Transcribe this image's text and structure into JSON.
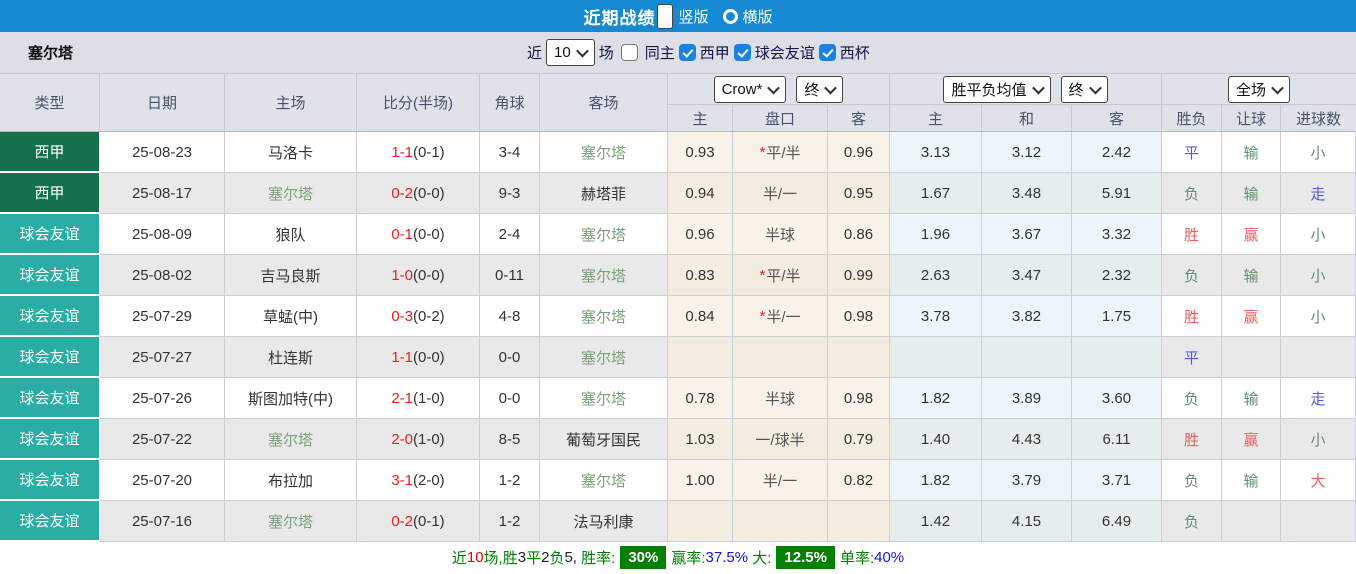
{
  "title_bar": {
    "title": "近期战绩",
    "radio_vertical": "竖版",
    "radio_horizontal": "横版"
  },
  "filter_bar": {
    "team": "塞尔塔",
    "near_label": "近",
    "count_value": "10",
    "games_label": "场",
    "same_home_label": "同主",
    "leagues": [
      "西甲",
      "球会友谊",
      "西杯"
    ]
  },
  "table": {
    "main_headers": [
      "类型",
      "日期",
      "主场",
      "比分(半场)",
      "角球",
      "客场"
    ],
    "group1": {
      "bookmaker_select": "Crow*",
      "stage_select": "终",
      "sub": [
        "主",
        "盘口",
        "客"
      ]
    },
    "group2": {
      "odds_select": "胜平负均值",
      "stage_select": "终",
      "sub": [
        "主",
        "和",
        "客"
      ]
    },
    "group3": {
      "scope_select": "全场",
      "sub": [
        "胜负",
        "让球",
        "进球数"
      ]
    },
    "type_colors": {
      "西甲": "#15714b",
      "球会友谊": "#2aada4"
    },
    "rows": [
      {
        "type": "西甲",
        "date": "25-08-23",
        "home": {
          "name": "马洛卡",
          "highlight": false
        },
        "score": {
          "full": "1-1",
          "half": "(0-1)"
        },
        "corners": "3-4",
        "away": {
          "name": "塞尔塔",
          "highlight": true
        },
        "crow": {
          "home": "0.93",
          "line_star": true,
          "line": "平/半",
          "away": "0.96"
        },
        "avg": {
          "home": "3.13",
          "draw": "3.12",
          "away": "2.42"
        },
        "outcome": {
          "text": "平",
          "color": "blue"
        },
        "handicap_result": {
          "text": "输",
          "color": "green"
        },
        "goals_result": {
          "text": "小",
          "color": "green"
        }
      },
      {
        "type": "西甲",
        "date": "25-08-17",
        "home": {
          "name": "塞尔塔",
          "highlight": true
        },
        "score": {
          "full": "0-2",
          "half": "(0-0)"
        },
        "corners": "9-3",
        "away": {
          "name": "赫塔菲",
          "highlight": false
        },
        "crow": {
          "home": "0.94",
          "line_star": false,
          "line": "半/一",
          "away": "0.95"
        },
        "avg": {
          "home": "1.67",
          "draw": "3.48",
          "away": "5.91"
        },
        "outcome": {
          "text": "负",
          "color": "green"
        },
        "handicap_result": {
          "text": "输",
          "color": "green"
        },
        "goals_result": {
          "text": "走",
          "color": "blue"
        }
      },
      {
        "type": "球会友谊",
        "date": "25-08-09",
        "home": {
          "name": "狼队",
          "highlight": false
        },
        "score": {
          "full": "0-1",
          "half": "(0-0)"
        },
        "corners": "2-4",
        "away": {
          "name": "塞尔塔",
          "highlight": true
        },
        "crow": {
          "home": "0.96",
          "line_star": false,
          "line": "半球",
          "away": "0.86"
        },
        "avg": {
          "home": "1.96",
          "draw": "3.67",
          "away": "3.32"
        },
        "outcome": {
          "text": "胜",
          "color": "red"
        },
        "handicap_result": {
          "text": "赢",
          "color": "red"
        },
        "goals_result": {
          "text": "小",
          "color": "green"
        }
      },
      {
        "type": "球会友谊",
        "date": "25-08-02",
        "home": {
          "name": "吉马良斯",
          "highlight": false
        },
        "score": {
          "full": "1-0",
          "half": "(0-0)"
        },
        "corners": "0-11",
        "away": {
          "name": "塞尔塔",
          "highlight": true
        },
        "crow": {
          "home": "0.83",
          "line_star": true,
          "line": "平/半",
          "away": "0.99"
        },
        "avg": {
          "home": "2.63",
          "draw": "3.47",
          "away": "2.32"
        },
        "outcome": {
          "text": "负",
          "color": "green"
        },
        "handicap_result": {
          "text": "输",
          "color": "green"
        },
        "goals_result": {
          "text": "小",
          "color": "green"
        }
      },
      {
        "type": "球会友谊",
        "date": "25-07-29",
        "home": {
          "name": "草蜢(中)",
          "highlight": false
        },
        "score": {
          "full": "0-3",
          "half": "(0-2)"
        },
        "corners": "4-8",
        "away": {
          "name": "塞尔塔",
          "highlight": true
        },
        "crow": {
          "home": "0.84",
          "line_star": true,
          "line": "半/一",
          "away": "0.98"
        },
        "avg": {
          "home": "3.78",
          "draw": "3.82",
          "away": "1.75"
        },
        "outcome": {
          "text": "胜",
          "color": "red"
        },
        "handicap_result": {
          "text": "赢",
          "color": "red"
        },
        "goals_result": {
          "text": "小",
          "color": "green"
        }
      },
      {
        "type": "球会友谊",
        "date": "25-07-27",
        "home": {
          "name": "杜连斯",
          "highlight": false
        },
        "score": {
          "full": "1-1",
          "half": "(0-0)"
        },
        "corners": "0-0",
        "away": {
          "name": "塞尔塔",
          "highlight": true
        },
        "crow": {
          "home": "",
          "line_star": false,
          "line": "",
          "away": ""
        },
        "avg": {
          "home": "",
          "draw": "",
          "away": ""
        },
        "outcome": {
          "text": "平",
          "color": "blue"
        },
        "handicap_result": {
          "text": "",
          "color": "green"
        },
        "goals_result": {
          "text": "",
          "color": "green"
        }
      },
      {
        "type": "球会友谊",
        "date": "25-07-26",
        "home": {
          "name": "斯图加特(中)",
          "highlight": false
        },
        "score": {
          "full": "2-1",
          "half": "(1-0)"
        },
        "corners": "0-0",
        "away": {
          "name": "塞尔塔",
          "highlight": true
        },
        "crow": {
          "home": "0.78",
          "line_star": false,
          "line": "半球",
          "away": "0.98"
        },
        "avg": {
          "home": "1.82",
          "draw": "3.89",
          "away": "3.60"
        },
        "outcome": {
          "text": "负",
          "color": "green"
        },
        "handicap_result": {
          "text": "输",
          "color": "green"
        },
        "goals_result": {
          "text": "走",
          "color": "blue"
        }
      },
      {
        "type": "球会友谊",
        "date": "25-07-22",
        "home": {
          "name": "塞尔塔",
          "highlight": true
        },
        "score": {
          "full": "2-0",
          "half": "(1-0)"
        },
        "corners": "8-5",
        "away": {
          "name": "葡萄牙国民",
          "highlight": false
        },
        "crow": {
          "home": "1.03",
          "line_star": false,
          "line": "一/球半",
          "away": "0.79"
        },
        "avg": {
          "home": "1.40",
          "draw": "4.43",
          "away": "6.11"
        },
        "outcome": {
          "text": "胜",
          "color": "red"
        },
        "handicap_result": {
          "text": "赢",
          "color": "red"
        },
        "goals_result": {
          "text": "小",
          "color": "green"
        }
      },
      {
        "type": "球会友谊",
        "date": "25-07-20",
        "home": {
          "name": "布拉加",
          "highlight": false
        },
        "score": {
          "full": "3-1",
          "half": "(2-0)"
        },
        "corners": "1-2",
        "away": {
          "name": "塞尔塔",
          "highlight": true
        },
        "crow": {
          "home": "1.00",
          "line_star": false,
          "line": "半/一",
          "away": "0.82"
        },
        "avg": {
          "home": "1.82",
          "draw": "3.79",
          "away": "3.71"
        },
        "outcome": {
          "text": "负",
          "color": "green"
        },
        "handicap_result": {
          "text": "输",
          "color": "green"
        },
        "goals_result": {
          "text": "大",
          "color": "red"
        }
      },
      {
        "type": "球会友谊",
        "date": "25-07-16",
        "home": {
          "name": "塞尔塔",
          "highlight": true
        },
        "score": {
          "full": "0-2",
          "half": "(0-1)"
        },
        "corners": "1-2",
        "away": {
          "name": "法马利康",
          "highlight": false
        },
        "crow": {
          "home": "",
          "line_star": false,
          "line": "",
          "away": ""
        },
        "avg": {
          "home": "1.42",
          "draw": "4.15",
          "away": "6.49"
        },
        "outcome": {
          "text": "负",
          "color": "green"
        },
        "handicap_result": {
          "text": "",
          "color": "green"
        },
        "goals_result": {
          "text": "",
          "color": "green"
        }
      }
    ]
  },
  "result_colors": {
    "red": "#ea5f5f",
    "green": "#5e9070",
    "blue": "#5757df"
  },
  "footer": {
    "colors": {
      "green": "#008000",
      "red": "#ee0000",
      "blue": "#1414e6",
      "black": "#222222",
      "badge_bg": "#028102"
    },
    "segments": [
      {
        "text": "近",
        "c": "green"
      },
      {
        "text": "10",
        "c": "red"
      },
      {
        "text": "场,",
        "c": "green"
      },
      {
        "text": "胜",
        "c": "green"
      },
      {
        "text": "3",
        "c": "black"
      },
      {
        "text": "平",
        "c": "green"
      },
      {
        "text": "2",
        "c": "black"
      },
      {
        "text": "负",
        "c": "green"
      },
      {
        "text": "5,",
        "c": "black"
      },
      {
        "text": " 胜率:",
        "c": "green"
      },
      {
        "text": "30%",
        "c": "badge"
      },
      {
        "text": "赢率:",
        "c": "green"
      },
      {
        "text": "37.5%",
        "c": "blue"
      },
      {
        "text": " 大:",
        "c": "green"
      },
      {
        "text": "12.5%",
        "c": "badge"
      },
      {
        "text": "单率:",
        "c": "green"
      },
      {
        "text": "40%",
        "c": "blue"
      }
    ]
  }
}
